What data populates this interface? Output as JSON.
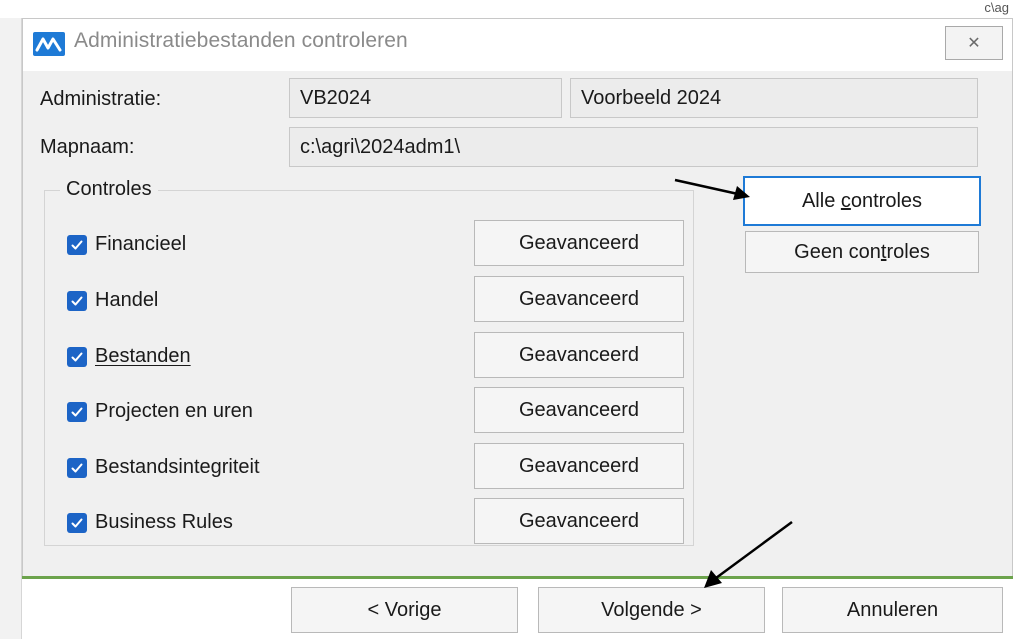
{
  "backdrop": {
    "corner_text": "c\\ag"
  },
  "dialog": {
    "title": "Administratiebestanden controleren",
    "close_glyph": "✕",
    "administratie": {
      "label": "Administratie:",
      "code": "VB2024",
      "name": "Voorbeeld 2024"
    },
    "mapnaam": {
      "label": "Mapnaam:",
      "path": "c:\\agri\\2024adm1\\"
    },
    "controles": {
      "title": "Controles",
      "items": [
        {
          "label": "Financieel",
          "checked": true,
          "button": "Geavanceerd"
        },
        {
          "label": "Handel",
          "checked": true,
          "button": "Geavanceerd"
        },
        {
          "label": "Bestanden",
          "checked": true,
          "button": "Geavanceerd"
        },
        {
          "label": "Projecten en uren",
          "checked": true,
          "button": "Geavanceerd"
        },
        {
          "label": "Bestandsintegriteit",
          "checked": true,
          "button": "Geavanceerd"
        },
        {
          "label": "Business Rules",
          "checked": true,
          "button": "Geavanceerd"
        }
      ]
    },
    "side_buttons": {
      "alle_pre": "Alle ",
      "alle_key": "c",
      "alle_post": "ontroles",
      "geen_pre": "Geen con",
      "geen_key": "t",
      "geen_post": "roles"
    },
    "footer": {
      "previous": "< Vorige",
      "next": "Volgende >",
      "cancel": "Annuleren"
    }
  },
  "colors": {
    "checkbox": "#1c64c6",
    "focus_border": "#1e7ad6",
    "separator": "#6ca34c",
    "annotation_arrow": "#000000"
  }
}
